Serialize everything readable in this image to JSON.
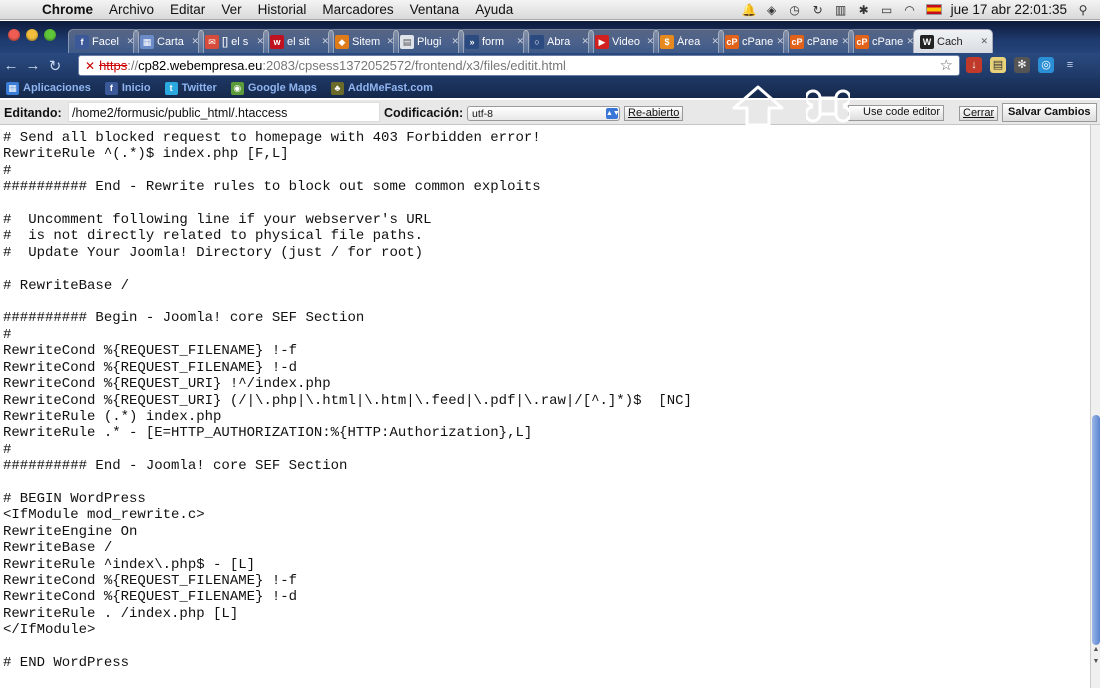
{
  "menubar": {
    "app": "Chrome",
    "items": [
      "Archivo",
      "Editar",
      "Ver",
      "Historial",
      "Marcadores",
      "Ventana",
      "Ayuda"
    ],
    "clock": "jue 17 abr  22:01:35"
  },
  "tabs": [
    {
      "label": "Facel",
      "fav_color": "#3b5998",
      "fav_glyph": "f"
    },
    {
      "label": "Carta",
      "fav_color": "#6b8cc9",
      "fav_glyph": "▦"
    },
    {
      "label": "[] el s",
      "fav_color": "#d64b3a",
      "fav_glyph": "✉"
    },
    {
      "label": "el sit",
      "fav_color": "#c0121e",
      "fav_glyph": "w"
    },
    {
      "label": "Sitem",
      "fav_color": "#e07b1a",
      "fav_glyph": "◆"
    },
    {
      "label": "Plugi",
      "fav_color": "#dfe3ea",
      "fav_glyph": "▤"
    },
    {
      "label": "form",
      "fav_color": "#2a4a80",
      "fav_glyph": "»"
    },
    {
      "label": "Abra",
      "fav_color": "#2a4a80",
      "fav_glyph": "○"
    },
    {
      "label": "Video",
      "fav_color": "#d21f1f",
      "fav_glyph": "▶"
    },
    {
      "label": "Área",
      "fav_color": "#e68a1f",
      "fav_glyph": "$"
    },
    {
      "label": "cPane",
      "fav_color": "#e2621a",
      "fav_glyph": "cP"
    },
    {
      "label": "cPane",
      "fav_color": "#e2621a",
      "fav_glyph": "cP"
    },
    {
      "label": "cPane",
      "fav_color": "#e2621a",
      "fav_glyph": "cP"
    },
    {
      "label": "Cach",
      "fav_color": "#222222",
      "fav_glyph": "W",
      "active": true
    }
  ],
  "omnibox": {
    "scheme": "https",
    "sep": "://",
    "host": "cp82.webempresa.eu",
    "rest": ":2083/cpsess1372052572/frontend/x3/files/editit.html"
  },
  "bookmarks": [
    {
      "label": "Aplicaciones",
      "icon": "apps-icon",
      "color": "#3a7bd5",
      "glyph": "▦"
    },
    {
      "label": "Inicio",
      "icon": "facebook-icon",
      "color": "#3b5998",
      "glyph": "f"
    },
    {
      "label": "Twitter",
      "icon": "twitter-icon",
      "color": "#2aa9e0",
      "glyph": "t"
    },
    {
      "label": "Google Maps",
      "icon": "maps-icon",
      "color": "#5b9b3a",
      "glyph": "◉"
    },
    {
      "label": "AddMeFast.com",
      "icon": "addmefast-icon",
      "color": "#6a6a2a",
      "glyph": "♣"
    }
  ],
  "editor": {
    "editing_label": "Editando:",
    "path": "/home2/formusic/public_html/.htaccess",
    "encoding_label": "Codificación:",
    "encoding_value": "utf-8",
    "reopen_label": "Re-abierto",
    "code_editor_label": "Use code editor",
    "close_label": "Cerrar",
    "save_label": "Salvar Cambios"
  },
  "code": "# Send all blocked request to homepage with 403 Forbidden error!\nRewriteRule ^(.*)$ index.php [F,L]\n#\n########## End - Rewrite rules to block out some common exploits\n\n#  Uncomment following line if your webserver's URL\n#  is not directly related to physical file paths.\n#  Update Your Joomla! Directory (just / for root)\n\n# RewriteBase /\n\n########## Begin - Joomla! core SEF Section\n#\nRewriteCond %{REQUEST_FILENAME} !-f\nRewriteCond %{REQUEST_FILENAME} !-d\nRewriteCond %{REQUEST_URI} !^/index.php\nRewriteCond %{REQUEST_URI} (/|\\.php|\\.html|\\.htm|\\.feed|\\.pdf|\\.raw|/[^.]*)$  [NC]\nRewriteRule (.*) index.php\nRewriteRule .* - [E=HTTP_AUTHORIZATION:%{HTTP:Authorization},L]\n#\n########## End - Joomla! core SEF Section\n\n# BEGIN WordPress\n<IfModule mod_rewrite.c>\nRewriteEngine On\nRewriteBase /\nRewriteRule ^index\\.php$ - [L]\nRewriteCond %{REQUEST_FILENAME} !-f\nRewriteCond %{REQUEST_FILENAME} !-d\nRewriteRule . /index.php [L]\n</IfModule>\n\n# END WordPress"
}
